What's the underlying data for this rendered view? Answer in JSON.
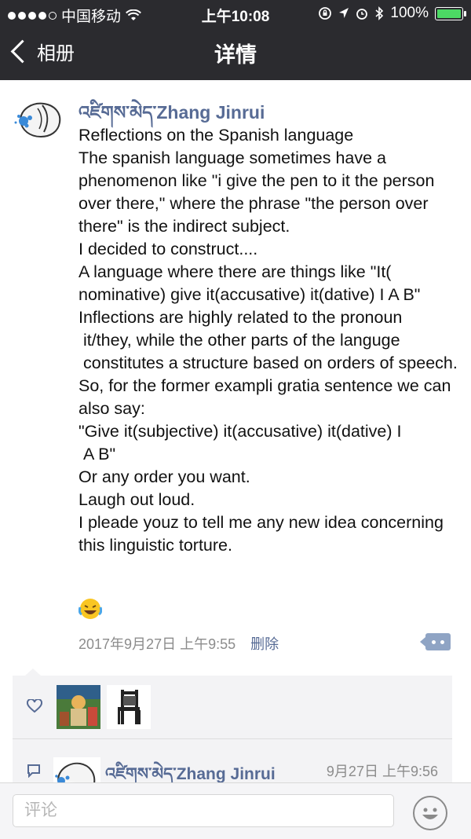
{
  "status_bar": {
    "carrier": "中国移动",
    "time": "上午10:08",
    "battery": "100%"
  },
  "navbar": {
    "back_label": "相册",
    "title": "详情"
  },
  "post": {
    "author": "འཛིགས་མེད་Zhang Jinrui",
    "lines": [
      "Reflections on the Spanish language",
      "The spanish language sometimes have a phenomenon like \"i give the pen to it the person over there,\" where the phrase \"the person over there\" is the indirect subject.",
      "I decided to construct....",
      "A language where there are things like \"It( nominative) give it(accusative) it(dative) I A B\"",
      "Inflections are highly related to the pronoun\n it/they, while the other parts of the languge\n constitutes a structure based on orders of speech.",
      "So, for the former exampli gratia sentence we can also say:",
      "\"Give it(subjective) it(accusative) it(dative) I\n A B\"",
      "Or any order you want.",
      "Laugh out loud.",
      "I pleade youz to tell me any new idea concerning this linguistic torture."
    ],
    "emoji": "laughing-with-tears",
    "timestamp": "2017年9月27日 上午9:55",
    "delete_label": "删除"
  },
  "comment": {
    "author": "འཛིགས་མེད་Zhang Jinrui",
    "time": "9月27日 上午9:56"
  },
  "comment_bar": {
    "placeholder": "评论"
  },
  "colors": {
    "nav_bg": "#2b2b2f",
    "link": "#576b95",
    "panel_bg": "#f3f3f5"
  }
}
